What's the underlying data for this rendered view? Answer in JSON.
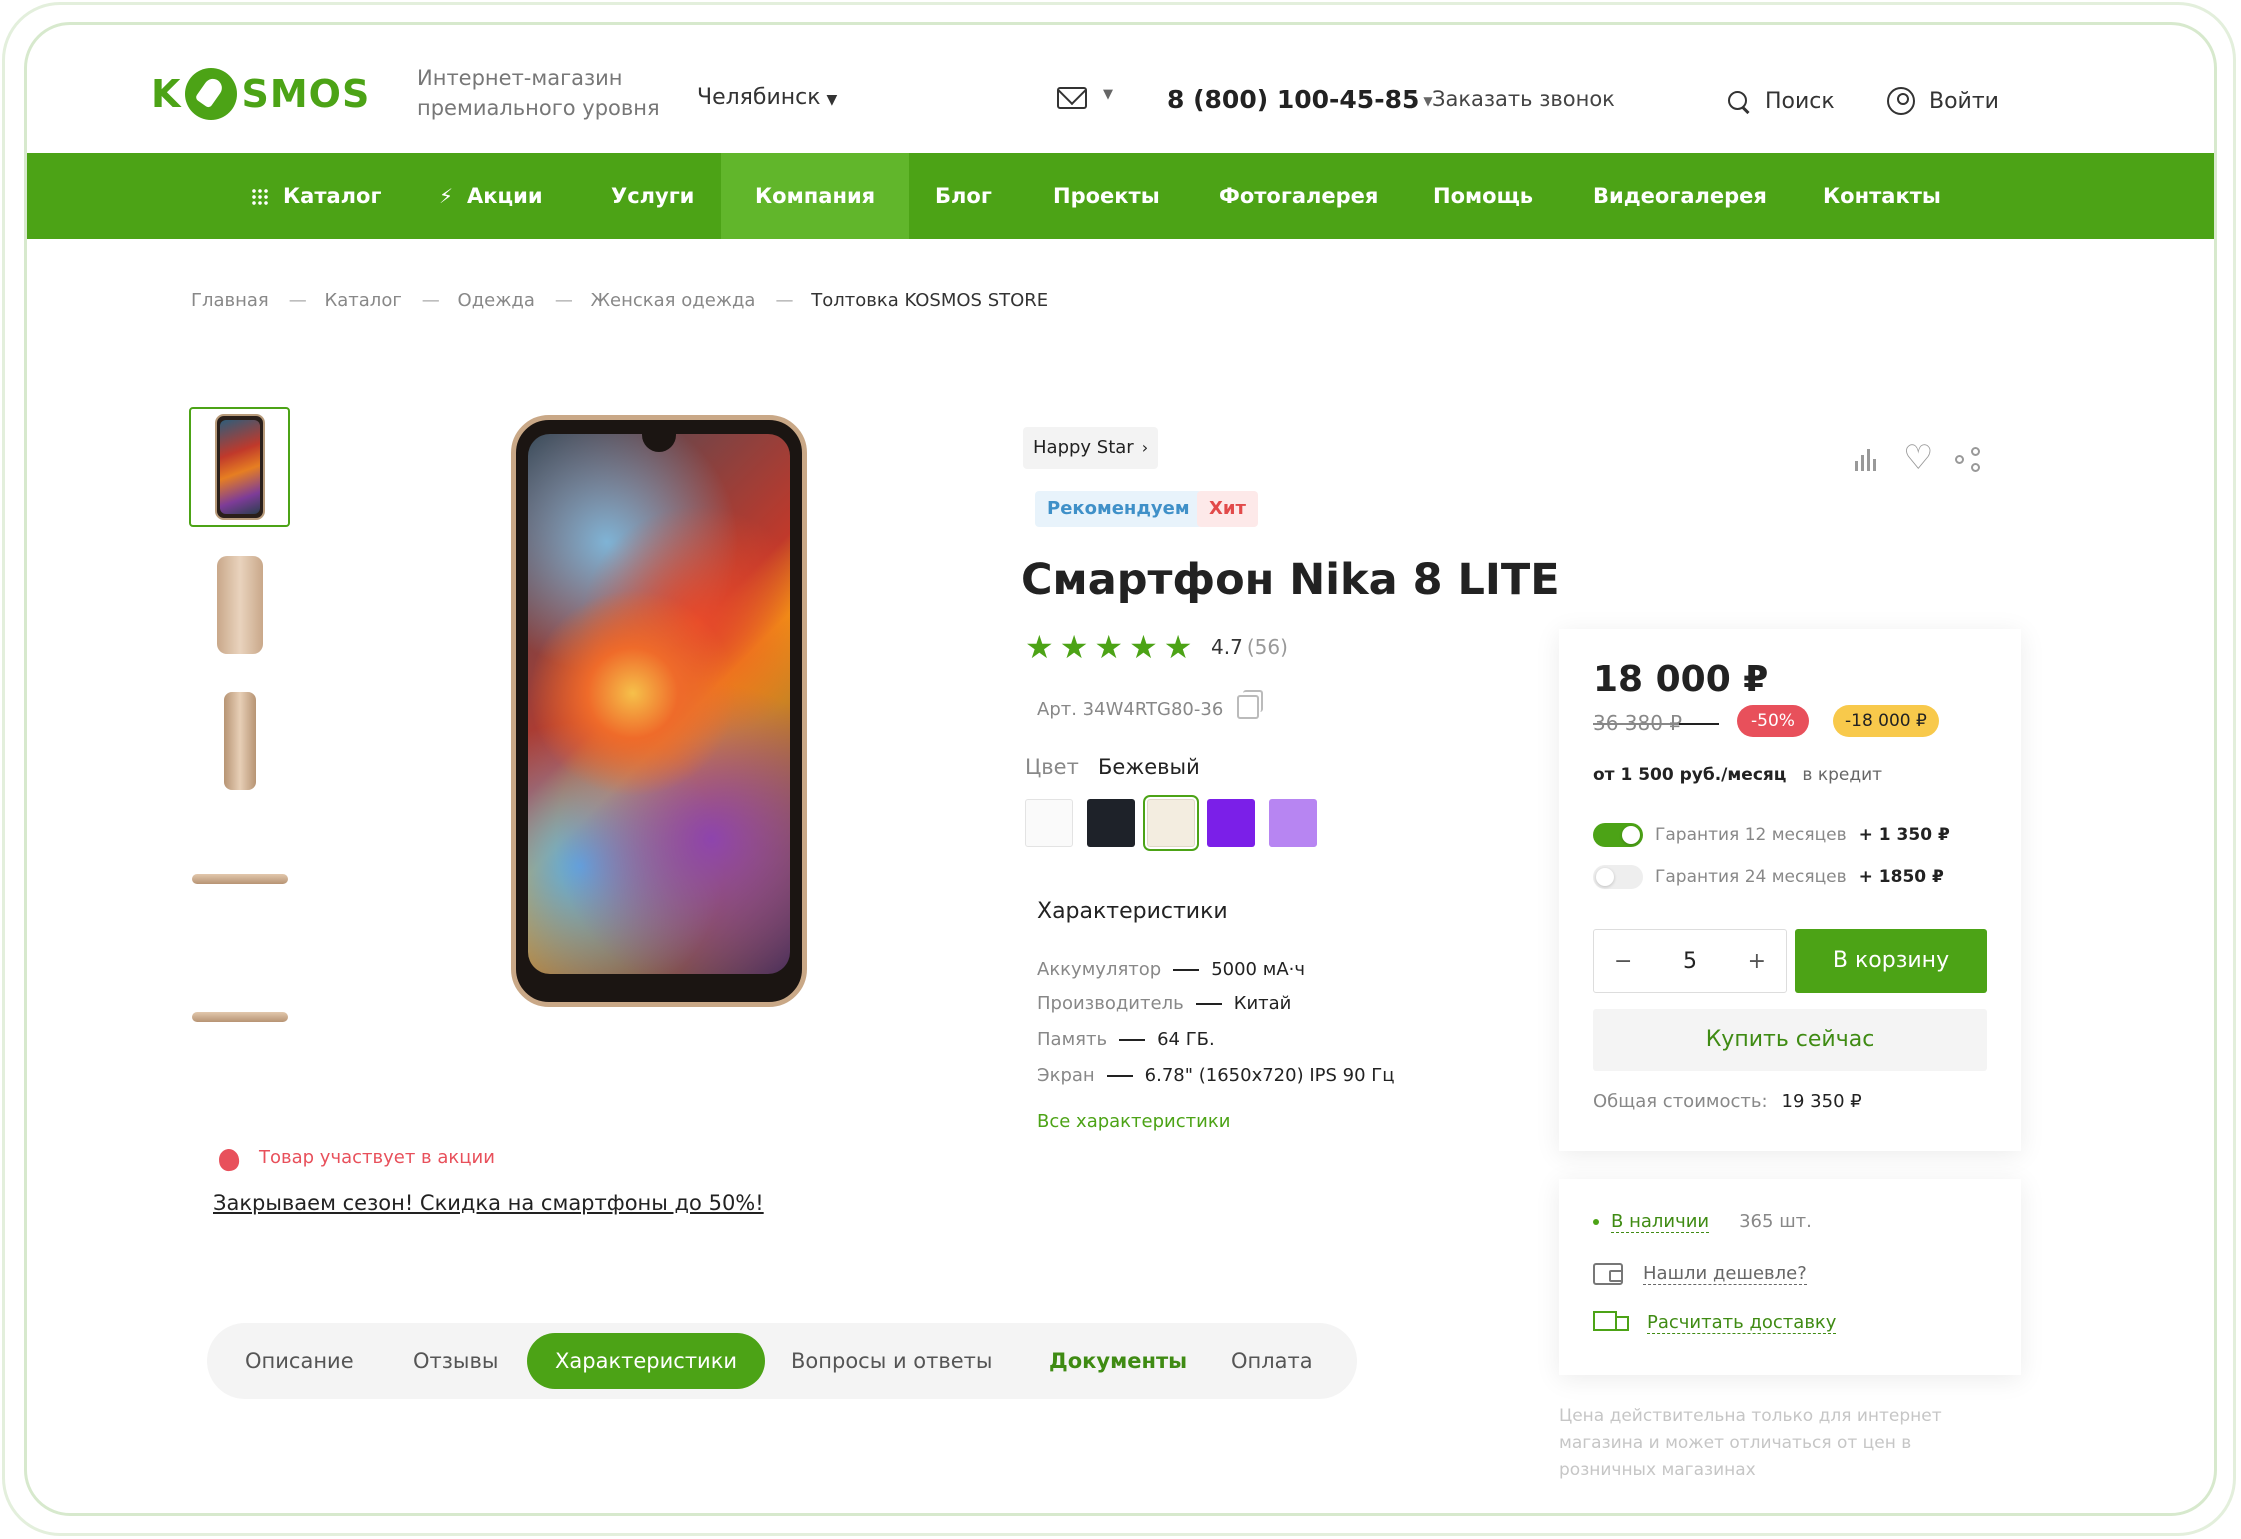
{
  "header": {
    "logo_text": "KOSMOS",
    "tagline": "Интернет-магазин премиального уровня",
    "city": "Челябинск",
    "phone": "8 (800) 100-45-85",
    "callback_label": "Заказать звонок",
    "search_label": "Поиск",
    "login_label": "Войти"
  },
  "nav": {
    "items": [
      {
        "label": "Каталог"
      },
      {
        "label": "Акции"
      },
      {
        "label": "Услуги"
      },
      {
        "label": "Компания"
      },
      {
        "label": "Блог"
      },
      {
        "label": "Проекты"
      },
      {
        "label": "Фотогалерея"
      },
      {
        "label": "Помощь"
      },
      {
        "label": "Видеогалерея"
      },
      {
        "label": "Контакты"
      }
    ],
    "active": "Компания",
    "accent_color": "#4ca316"
  },
  "breadcrumb": [
    "Главная",
    "Каталог",
    "Одежда",
    "Женская одежда",
    "Толтовка KOSMOS STORE"
  ],
  "gallery": {
    "thumbs": [
      "phone-front",
      "phone-back",
      "phone-side",
      "phone-edge-top",
      "phone-edge-bottom"
    ],
    "promo_text": "Товар участвует в акции",
    "promo_link": "Закрываем сезон! Скидка на смартфоны до 50%!"
  },
  "product": {
    "brand": "Happy Star",
    "badges": [
      "Рекомендуем",
      "Хит"
    ],
    "title": "Смартфон Nika 8 LITE",
    "rating": "4.7",
    "rating_count": "(56)",
    "rating_stars": 5,
    "article": "Арт. 34W4RTG80-36",
    "color_label": "Цвет",
    "color_value": "Бежевый",
    "colors": [
      "#fafafa",
      "#1e2229",
      "#f3ede0",
      "#7b1fe8",
      "#b785f2"
    ],
    "selected_color_index": 2,
    "specs_title": "Характеристики",
    "specs": [
      {
        "key": "Аккумулятор",
        "value": "5000 мА·ч"
      },
      {
        "key": "Производитель",
        "value": "Китай"
      },
      {
        "key": "Память",
        "value": "64 ГБ."
      },
      {
        "key": "Экран",
        "value": "6.78\" (1650x720) IPS 90 Гц"
      }
    ],
    "all_specs_label": "Все характеристики"
  },
  "price_card": {
    "price": "18 000 ₽",
    "old_price": "36 380 ₽",
    "discount": "-50%",
    "saving": "-18 000 ₽",
    "credit_amount": "от 1 500 руб./месяц",
    "credit_label": "в кредит",
    "warranty": [
      {
        "label": "Гарантия 12 месяцев",
        "price": "+ 1 350 ₽",
        "enabled": true
      },
      {
        "label": "Гарантия 24 месяцев",
        "price": "+ 1850 ₽",
        "enabled": false
      }
    ],
    "qty_minus": "−",
    "qty_value": "5",
    "qty_plus": "+",
    "cart_label": "В корзину",
    "buy_now_label": "Купить сейчас",
    "total_label": "Общая стоимость:",
    "total_value": "19 350 ₽"
  },
  "availability": {
    "stock_label": "В наличии",
    "stock_count": "365 шт.",
    "cheaper_label": "Нашли дешевле?",
    "delivery_label": "Расчитать доставку"
  },
  "price_note": "Цена действительна только для интернет магазина и может отличаться от цен в розничных магазинах",
  "tabs": {
    "items": [
      "Описание",
      "Отзывы",
      "Характеристики",
      "Вопросы и ответы",
      "Документы",
      "Оплата"
    ],
    "active": "Характеристики"
  }
}
